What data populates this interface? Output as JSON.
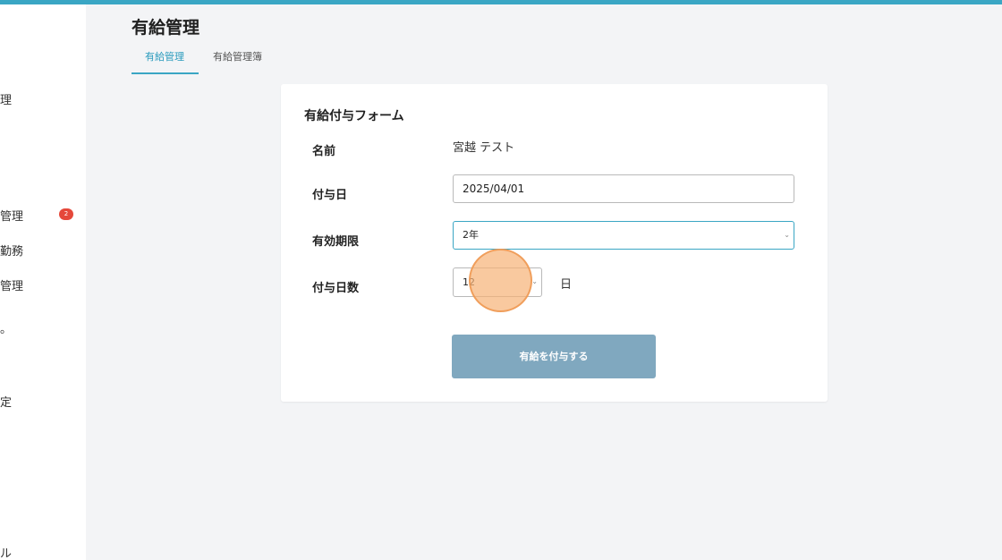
{
  "colors": {
    "accent": "#3aa6c4",
    "badge": "#e5483a",
    "submit_button": "#80a8bf",
    "background": "#f3f4f6"
  },
  "sidebar": {
    "items": [
      {
        "label": "理"
      },
      {
        "label": "管理",
        "badge": "2"
      },
      {
        "label": "勤務"
      },
      {
        "label": "管理"
      },
      {
        "label": "。"
      },
      {
        "label": "定"
      },
      {
        "label": "ル"
      }
    ]
  },
  "page": {
    "title": "有給管理",
    "tabs": [
      {
        "label": "有給管理",
        "active": true
      },
      {
        "label": "有給管理簿",
        "active": false
      }
    ]
  },
  "form": {
    "title": "有給付与フォーム",
    "name_label": "名前",
    "name_value": "宮越 テスト",
    "grant_date_label": "付与日",
    "grant_date_value": "2025/04/01",
    "validity_label": "有効期限",
    "validity_value": "2年",
    "days_label": "付与日数",
    "days_value": "12",
    "days_unit": "日",
    "submit_label": "有給を付与する"
  },
  "icons": {
    "dropdown": "chevron-down-icon",
    "cursor": "click-indicator"
  }
}
